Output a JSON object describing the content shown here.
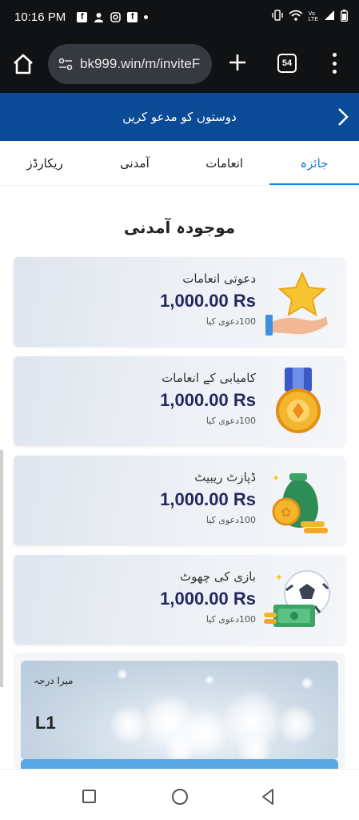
{
  "status_bar": {
    "time": "10:16 PM",
    "icons": [
      "facebook-icon",
      "person-icon",
      "instagram-icon",
      "facebook-icon",
      "dot-icon"
    ],
    "right_icons": [
      "vibrate-icon",
      "wifi-icon",
      "volte-icon",
      "signal-icon",
      "battery-icon"
    ],
    "volte_label": "Vo\nLTE"
  },
  "browser": {
    "url": "bk999.win/m/inviteF",
    "tab_count": "54"
  },
  "header": {
    "title": "دوستوں کو مدعو کریں"
  },
  "tabs": [
    {
      "label": "جائزہ",
      "active": true
    },
    {
      "label": "انعامات",
      "active": false
    },
    {
      "label": "آمدنی",
      "active": false
    },
    {
      "label": "ریکارڈز",
      "active": false
    }
  ],
  "section_title": "موجودہ آمدنی",
  "cards": [
    {
      "title": "دعوتی انعامات",
      "amount": "1,000.00 Rs",
      "sub": "100دعوی کیا",
      "icon": "star-hand-icon"
    },
    {
      "title": "کامیابی کے انعامات",
      "amount": "1,000.00 Rs",
      "sub": "100دعوی کیا",
      "icon": "medal-icon"
    },
    {
      "title": "ڈپازٹ ریبیٹ",
      "amount": "1,000.00 Rs",
      "sub": "100دعوی کیا",
      "icon": "money-bag-icon"
    },
    {
      "title": "بازی کی چھوٹ",
      "amount": "1,000.00 Rs",
      "sub": "100دعوی کیا",
      "icon": "football-cash-icon"
    }
  ],
  "level": {
    "label": "میرا درجہ",
    "value": "L1"
  },
  "colors": {
    "header_bg": "#0a4a96",
    "tab_active": "#1a7fd6",
    "amount": "#23285e"
  }
}
